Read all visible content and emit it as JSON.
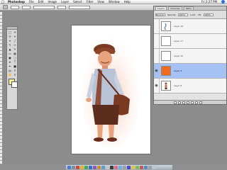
{
  "menubar": {
    "apple": "",
    "app_name": "Photoshop",
    "menus": [
      "File",
      "Edit",
      "Image",
      "Layer",
      "Select",
      "Filter",
      "View",
      "Window",
      "Help"
    ],
    "clock": "Fri 2:27 PM"
  },
  "layers_panel": {
    "tabs": [
      "Layers",
      "Channels",
      "Paths"
    ],
    "blend_mode": "Normal",
    "opacity_label": "Opacity:",
    "opacity": "100%",
    "lock_label": "Lock:",
    "fill_label": "Fill:",
    "fill": "100%",
    "layers": [
      {
        "name": "Layer 19",
        "visible": false,
        "selected": false,
        "thumb": "sketch-blue"
      },
      {
        "name": "Layer 17",
        "visible": false,
        "selected": false,
        "thumb": "white"
      },
      {
        "name": "Layer 10",
        "visible": false,
        "selected": false,
        "thumb": "white"
      },
      {
        "name": "Layer 9",
        "visible": true,
        "selected": true,
        "thumb": "orange"
      },
      {
        "name": "Layer 8",
        "visible": true,
        "selected": false,
        "thumb": "figure"
      }
    ]
  },
  "colors": {
    "selected_row": "#a6c2f4",
    "orange_thumb": "#f06a1f",
    "foreground_swatch": "#f2f09a",
    "background_swatch": "#ffffff"
  }
}
